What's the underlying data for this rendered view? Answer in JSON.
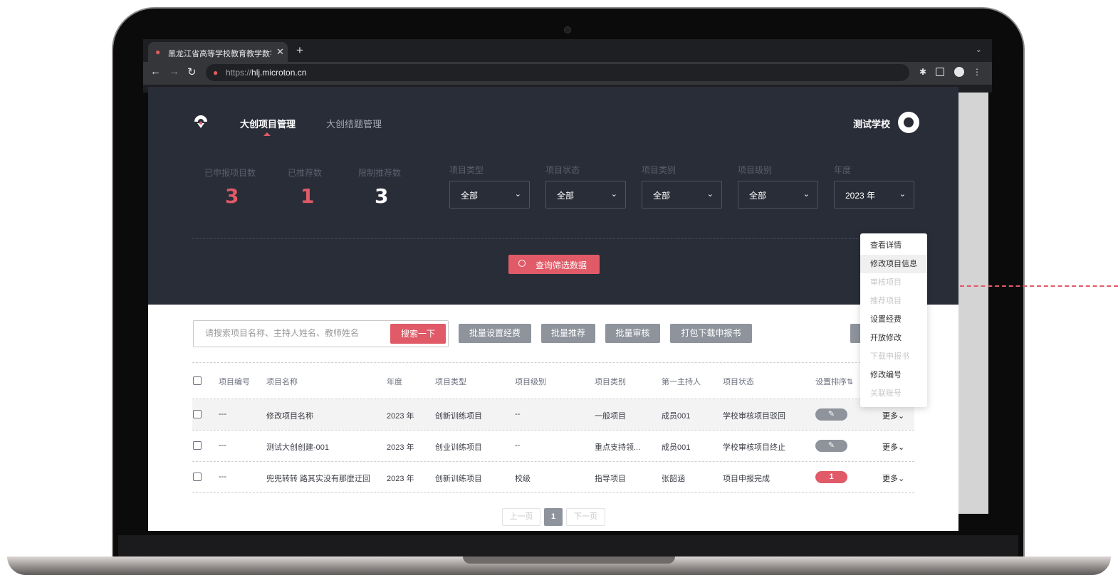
{
  "browser": {
    "tab_title": "黑龙江省高等学校教育教学数字化",
    "tab_close": "✕",
    "new_tab": "+",
    "tablist": "⌄",
    "url_scheme": "https://",
    "url_host": "hlj.microton.cn"
  },
  "header": {
    "nav": [
      "大创项目管理",
      "大创结题管理"
    ],
    "school_name": "测试学校"
  },
  "stats": [
    {
      "label": "已申报项目数",
      "value": "3",
      "color": "#e05a67"
    },
    {
      "label": "已推荐数",
      "value": "1",
      "color": "#e05a67"
    },
    {
      "label": "限制推荐数",
      "value": "3",
      "color": "#ffffff"
    }
  ],
  "filters": [
    {
      "label": "项目类型",
      "value": "全部"
    },
    {
      "label": "项目状态",
      "value": "全部"
    },
    {
      "label": "项目类别",
      "value": "全部"
    },
    {
      "label": "项目级别",
      "value": "全部"
    },
    {
      "label": "年度",
      "value": "2023 年"
    }
  ],
  "query_button": "查询筛选数据",
  "search": {
    "placeholder": "请搜索项目名称、主持人姓名、教师姓名",
    "button": "搜索一下"
  },
  "batch_buttons": [
    "批量设置经费",
    "批量推荐",
    "批量审核",
    "打包下载申报书"
  ],
  "table": {
    "headers": [
      "项目编号",
      "项目名称",
      "年度",
      "项目类型",
      "项目级别",
      "项目类别",
      "第一主持人",
      "项目状态",
      "设置排序⇅"
    ],
    "rows": [
      {
        "id": "---",
        "name": "修改项目名称",
        "year": "2023 年",
        "type": "创新训练项目",
        "level": "--",
        "category": "一般项目",
        "host": "成员001",
        "status": "学校审核项目驳回",
        "sort": "✎",
        "sort_style": "gray",
        "more": "更多⌄"
      },
      {
        "id": "---",
        "name": "测试大创创建-001",
        "year": "2023 年",
        "type": "创业训练项目",
        "level": "--",
        "category": "重点支持领...",
        "host": "成员001",
        "status": "学校审核项目终止",
        "sort": "✎",
        "sort_style": "gray",
        "more": "更多⌄"
      },
      {
        "id": "---",
        "name": "兜兜转转 路其实没有那麼迂回",
        "year": "2023 年",
        "type": "创新训练项目",
        "level": "校级",
        "category": "指导项目",
        "host": "张韶涵",
        "status": "项目申报完成",
        "sort": "1",
        "sort_style": "red",
        "more": "更多⌄"
      }
    ]
  },
  "pagination": {
    "prev": "上一页",
    "current": "1",
    "next": "下一页"
  },
  "dropdown_menu": [
    {
      "label": "查看详情",
      "enabled": true
    },
    {
      "label": "修改项目信息",
      "enabled": true
    },
    {
      "label": "审核项目",
      "enabled": false
    },
    {
      "label": "推荐项目",
      "enabled": false
    },
    {
      "label": "设置经费",
      "enabled": true
    },
    {
      "label": "开放修改",
      "enabled": true
    },
    {
      "label": "下载申报书",
      "enabled": false
    },
    {
      "label": "修改编号",
      "enabled": true
    },
    {
      "label": "关联账号",
      "enabled": false
    }
  ],
  "colors": {
    "accent": "#e05a67",
    "dark_bg": "#292d38",
    "button_gray": "#8e939c"
  }
}
